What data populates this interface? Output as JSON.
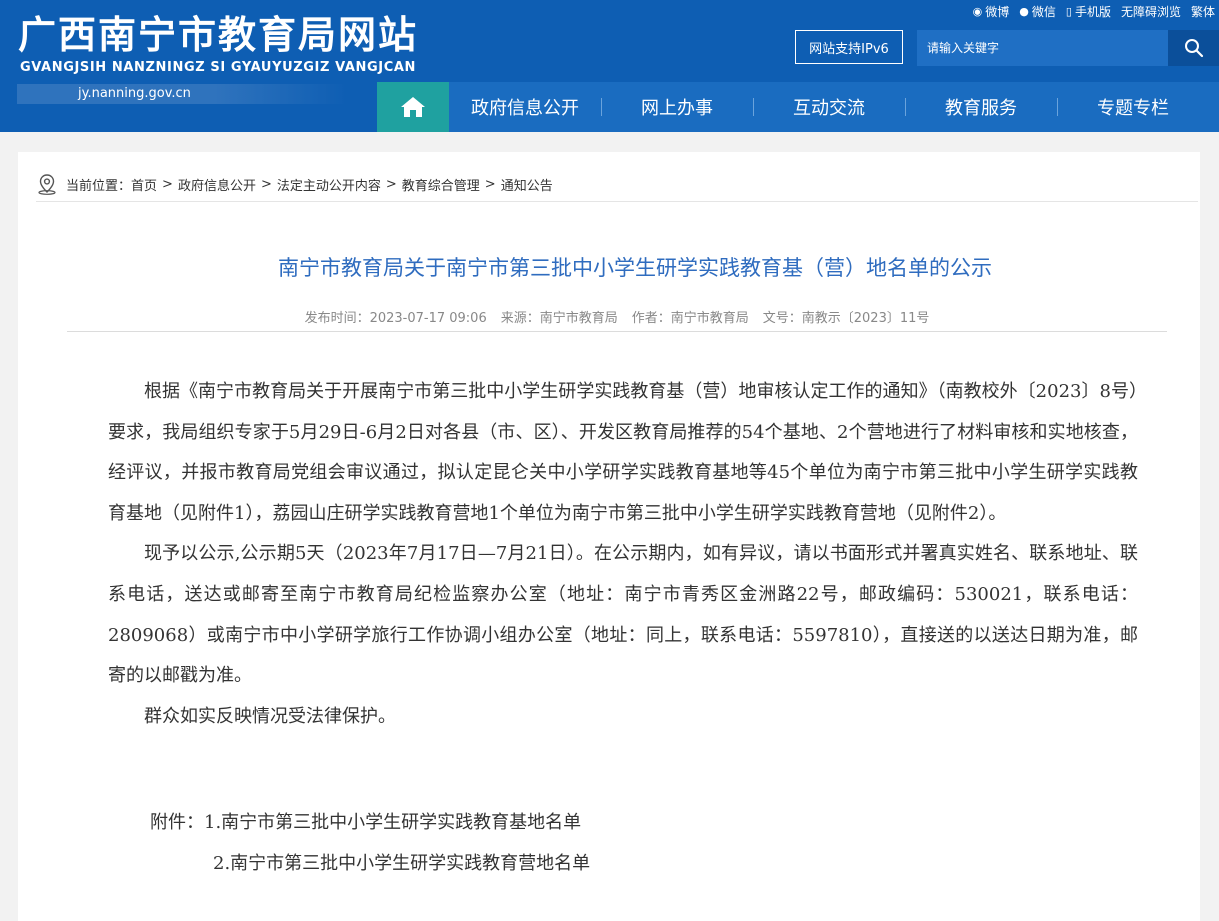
{
  "header": {
    "site_title": "广西南宁市教育局网站",
    "site_pinyin": "GVANGJSIH NANZNINGZ SI GYAUYUZGIZ VANGJCAN",
    "site_url": "jy.nanning.gov.cn",
    "top_links": [
      "微博",
      "微信",
      "手机版",
      "无障碍浏览",
      "繁体"
    ],
    "ipv6_label": "网站支持IPv6",
    "search_placeholder": "请输入关键字"
  },
  "nav": {
    "items": [
      "政府信息公开",
      "网上办事",
      "互动交流",
      "教育服务",
      "专题专栏"
    ]
  },
  "breadcrumb": {
    "label": "当前位置：",
    "items": [
      "首页",
      "政府信息公开",
      "法定主动公开内容",
      "教育综合管理",
      "通知公告"
    ],
    "separator": ">"
  },
  "article": {
    "title": "南宁市教育局关于南宁市第三批中小学生研学实践教育基（营）地名单的公示",
    "meta": {
      "publish_time": "发布时间：2023-07-17 09:06",
      "source": "来源：南宁市教育局",
      "author": "作者：南宁市教育局",
      "doc_no": "文号：南教示〔2023〕11号"
    },
    "paragraphs": [
      "根据《南宁市教育局关于开展南宁市第三批中小学生研学实践教育基（营）地审核认定工作的通知》（南教校外〔2023〕8号）要求，我局组织专家于5月29日-6月2日对各县（市、区）、开发区教育局推荐的54个基地、2个营地进行了材料审核和实地核查，经评议，并报市教育局党组会审议通过，拟认定昆仑关中小学研学实践教育基地等45个单位为南宁市第三批中小学生研学实践教育基地（见附件1），荔园山庄研学实践教育营地1个单位为南宁市第三批中小学生研学实践教育营地（见附件2）。",
      "现予以公示,公示期5天（2023年7月17日—7月21日）。在公示期内，如有异议，请以书面形式并署真实姓名、联系地址、联系电话，送达或邮寄至南宁市教育局纪检监察办公室（地址：南宁市青秀区金洲路22号，邮政编码：530021，联系电话：2809068）或南宁市中小学研学旅行工作协调小组办公室（地址：同上，联系电话：5597810），直接送的以送达日期为准，邮寄的以邮戳为准。",
      "群众如实反映情况受法律保护。"
    ],
    "attachments": {
      "label": "附件：",
      "items": [
        "1.南宁市第三批中小学生研学实践教育基地名单",
        "2.南宁市第三批中小学生研学实践教育营地名单"
      ]
    }
  }
}
